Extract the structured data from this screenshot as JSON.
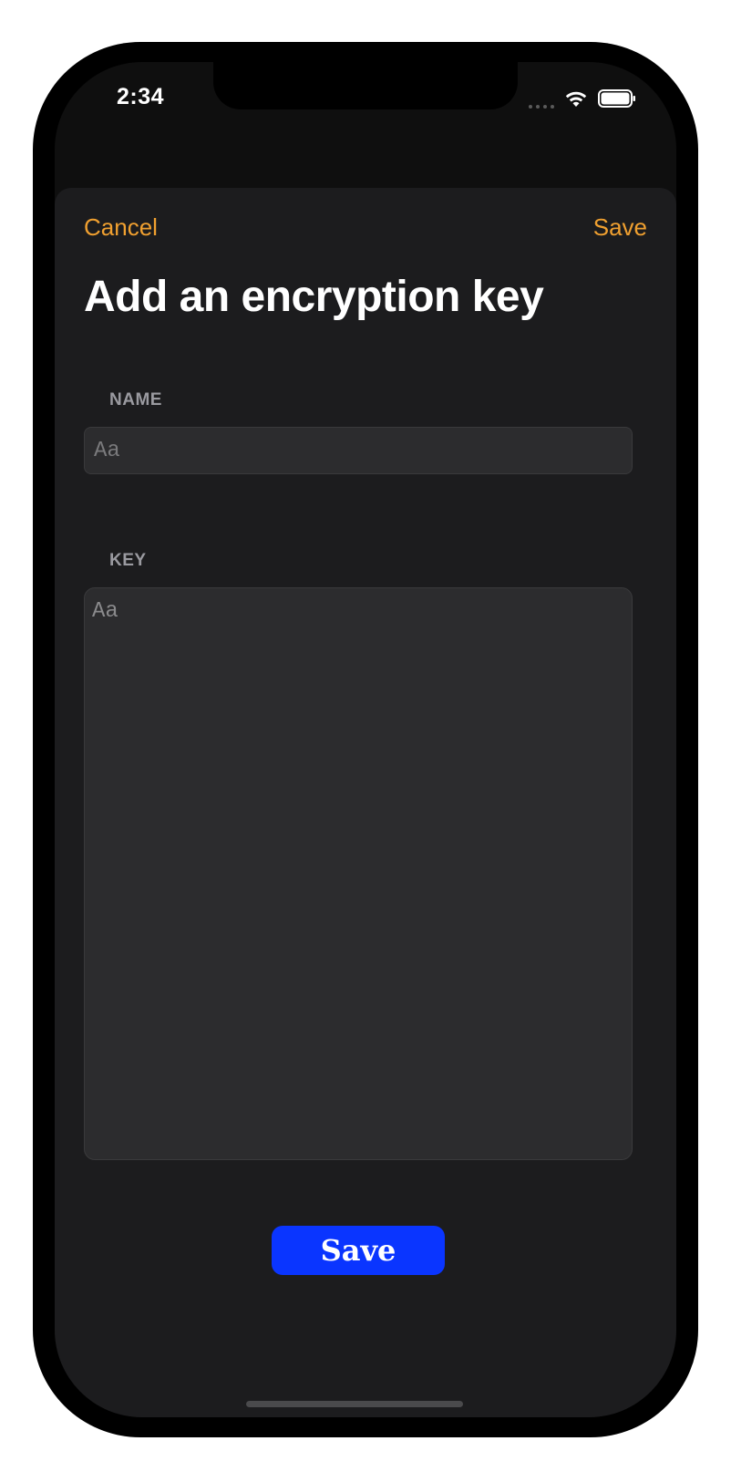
{
  "status_bar": {
    "time": "2:34",
    "icons": [
      "cellular-signal-icon",
      "wifi-icon",
      "battery-icon"
    ]
  },
  "nav": {
    "cancel_label": "Cancel",
    "save_label": "Save"
  },
  "page": {
    "title": "Add an encryption key"
  },
  "form": {
    "name": {
      "label": "NAME",
      "placeholder": "Aa",
      "value": ""
    },
    "key": {
      "label": "KEY",
      "placeholder": "Aa",
      "value": ""
    }
  },
  "actions": {
    "save_label": "Save"
  },
  "colors": {
    "accent": "#f0a030",
    "primary_button": "#0a35ff",
    "background": "#1c1c1e",
    "field_background": "#2c2c2e"
  }
}
